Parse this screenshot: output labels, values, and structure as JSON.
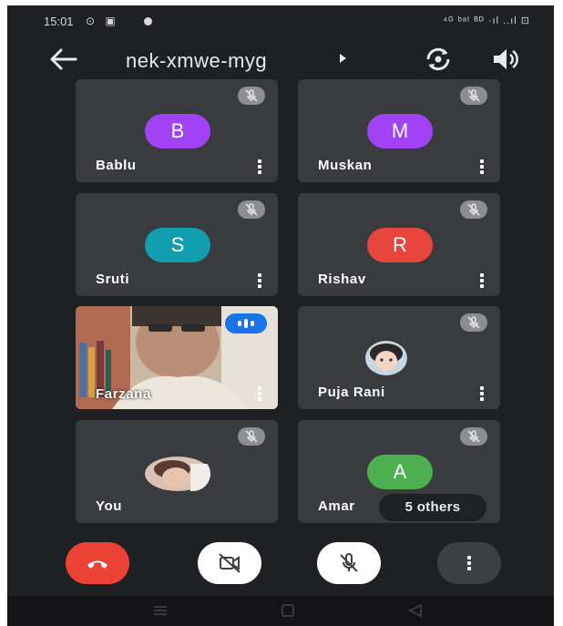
{
  "status_bar": {
    "time": "15:01",
    "icons_left": "⊙ ▣",
    "icons_right": "⁴ᴳ ᵇᵃᵗ ᴮᴰ ·ıl ..ıl ⊡"
  },
  "header": {
    "title": "nek-xmwe-myg",
    "back_icon": "arrow-left-icon",
    "switch_camera_icon": "switch-camera-icon",
    "speaker_icon": "speaker-icon"
  },
  "participants": [
    {
      "name": "Bablu",
      "initial": "B",
      "color": "#a142f4"
    },
    {
      "name": "Muskan",
      "initial": "M",
      "color": "#a142f4"
    },
    {
      "name": "Sruti",
      "initial": "S",
      "color": "#129eaf"
    },
    {
      "name": "Rishav",
      "initial": "R",
      "color": "#e8453c"
    },
    {
      "name": "Farzana",
      "video": true
    },
    {
      "name": "Puja Rani",
      "photo": true
    },
    {
      "name": "You",
      "photo": true
    },
    {
      "name": "Amar",
      "initial": "A",
      "color": "#4caf50"
    }
  ],
  "others_label": "5 others",
  "controls": {
    "end_call_color": "#ea4335",
    "camera": "camera-off",
    "microphone": "mic-off",
    "more": "more-options"
  }
}
